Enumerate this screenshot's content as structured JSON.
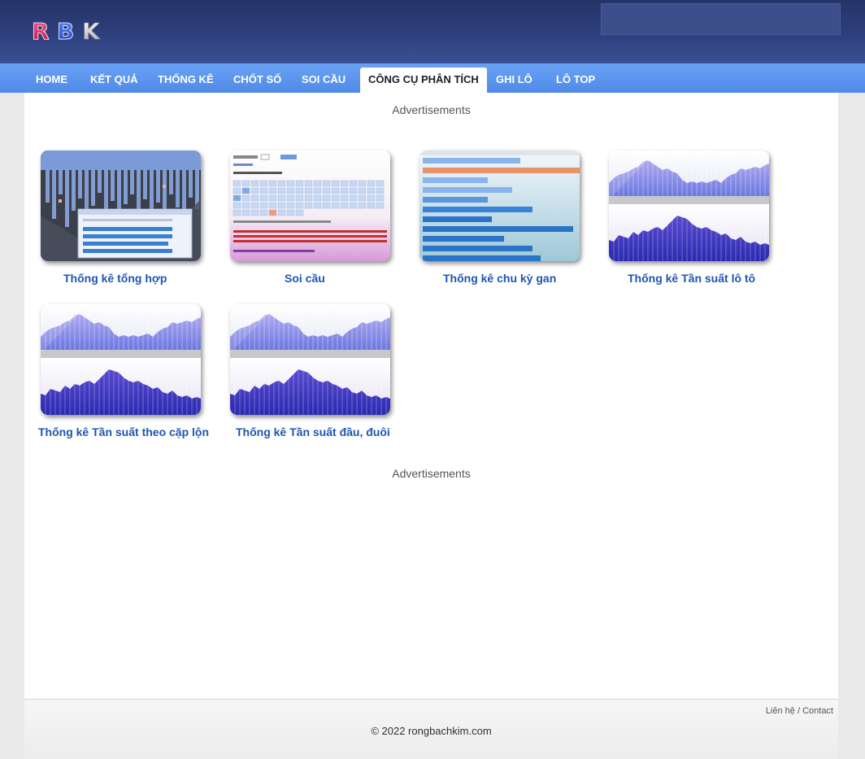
{
  "logo": {
    "text": "RBK"
  },
  "nav": {
    "items": [
      {
        "label": "HOME"
      },
      {
        "label": "KẾT QUẢ"
      },
      {
        "label": "THỐNG KÊ"
      },
      {
        "label": "CHỐT SỐ"
      },
      {
        "label": "SOI CẦU"
      },
      {
        "label": "CÔNG CỤ PHÂN TÍCH",
        "active": true
      },
      {
        "label": "GHI LÔ"
      },
      {
        "label": "LÔ TOP"
      }
    ]
  },
  "ads": {
    "top": "Advertisements",
    "bottom": "Advertisements"
  },
  "tools": [
    {
      "label": "Thống kê tổng hợp"
    },
    {
      "label": "Soi cầu"
    },
    {
      "label": "Thống kê chu kỳ gan"
    },
    {
      "label": "Thống kê Tần suất lô tô"
    },
    {
      "label": "Thống kê Tần suất theo cặp lộn"
    },
    {
      "label": "Thống kê Tần suất đầu, đuôi"
    }
  ],
  "footer": {
    "contact_vi": "Liên hệ",
    "separator": " / ",
    "contact_en": "Contact",
    "copyright": "© 2022 rongbachkim.com"
  },
  "colors": {
    "header": "#2e3f7d",
    "nav": "#5b95ee",
    "link": "#1e56b0"
  }
}
